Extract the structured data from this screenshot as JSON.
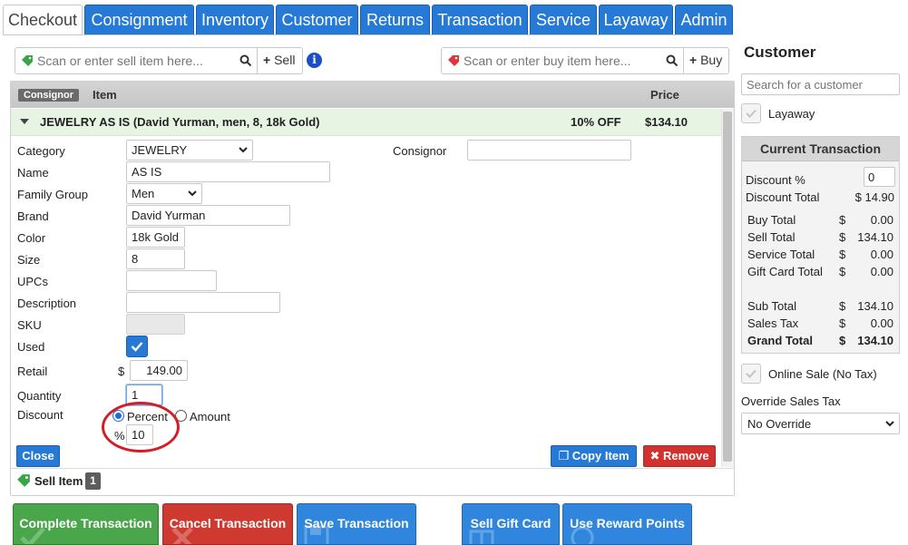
{
  "tabs": [
    "Checkout",
    "Consignment",
    "Inventory",
    "Customer",
    "Returns",
    "Transaction",
    "Service",
    "Layaway",
    "Admin"
  ],
  "scan": {
    "sell_placeholder": "Scan or enter sell item here...",
    "sell_button": "Sell",
    "buy_placeholder": "Scan or enter buy item here...",
    "buy_button": "Buy"
  },
  "table_header": {
    "consignor_badge": "Consignor",
    "item": "Item",
    "price": "Price"
  },
  "item": {
    "title": "JEWELRY AS IS (David Yurman, men, 8, 18k Gold)",
    "discount_text": "10% OFF",
    "price": "$134.10"
  },
  "form": {
    "category_label": "Category",
    "category_value": "JEWELRY",
    "consignor_label": "Consignor",
    "consignor_value": "",
    "name_label": "Name",
    "name_value": "AS IS",
    "family_group_label": "Family Group",
    "family_group_value": "Men",
    "brand_label": "Brand",
    "brand_value": "David Yurman",
    "color_label": "Color",
    "color_value": "18k Gold",
    "size_label": "Size",
    "size_value": "8",
    "upcs_label": "UPCs",
    "upcs_value": "",
    "description_label": "Description",
    "description_value": "",
    "sku_label": "SKU",
    "sku_value": "",
    "used_label": "Used",
    "retail_label": "Retail",
    "retail_currency": "$",
    "retail_value": "149.00",
    "quantity_label": "Quantity",
    "quantity_value": "1",
    "discount_label": "Discount",
    "discount_percent_option": "Percent",
    "discount_amount_option": "Amount",
    "discount_symbol": "%",
    "discount_value": "10"
  },
  "item_buttons": {
    "close": "Close",
    "copy": "Copy Item",
    "remove": "Remove"
  },
  "sell_item_bar": {
    "label": "Sell Item",
    "count": "1"
  },
  "bottom_buttons": {
    "complete": "Complete Transaction",
    "cancel": "Cancel Transaction",
    "save": "Save Transaction",
    "gift": "Sell Gift Card",
    "reward": "Use Reward Points"
  },
  "sidebar": {
    "title": "Customer",
    "search_placeholder": "Search for a customer",
    "layaway_label": "Layaway",
    "current_transaction": {
      "heading": "Current Transaction",
      "discount_pct_label": "Discount %",
      "discount_pct_value": "0",
      "discount_total_label": "Discount Total",
      "discount_total_value": "$ 14.90",
      "rows": [
        {
          "label": "Buy Total",
          "currency": "$",
          "value": "0.00"
        },
        {
          "label": "Sell Total",
          "currency": "$",
          "value": "134.10"
        },
        {
          "label": "Service Total",
          "currency": "$",
          "value": "0.00"
        },
        {
          "label": "Gift Card Total",
          "currency": "$",
          "value": "0.00"
        },
        {
          "label": "Sub Total",
          "currency": "$",
          "value": "134.10"
        },
        {
          "label": "Sales Tax",
          "currency": "$",
          "value": "0.00"
        },
        {
          "label": "Grand Total",
          "currency": "$",
          "value": "134.10"
        }
      ]
    },
    "online_sale_label": "Online Sale (No Tax)",
    "override_label": "Override Sales Tax",
    "override_value": "No Override"
  },
  "colors": {
    "tab_blue": "#2779d6",
    "success_green": "#4aa64a",
    "danger_red": "#d2322d",
    "annotation_red": "#d31e26"
  }
}
